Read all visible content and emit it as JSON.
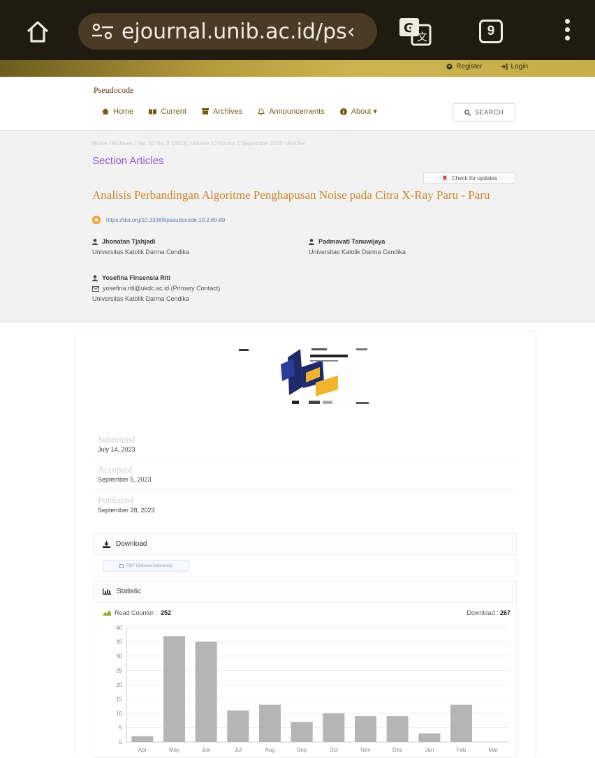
{
  "browser": {
    "url": "ejournal.unib.ac.id/ps‹",
    "tab_count": "9"
  },
  "top_bar": {
    "register_label": "Register",
    "login_label": "Login"
  },
  "site": {
    "brand": "Pseudocode",
    "nav": [
      {
        "label": "Home",
        "icon": "home-icon"
      },
      {
        "label": "Current",
        "icon": "book-icon"
      },
      {
        "label": "Archives",
        "icon": "archive-icon"
      },
      {
        "label": "Announcements",
        "icon": "bell-icon"
      },
      {
        "label": "About ▾",
        "icon": "info-icon"
      }
    ],
    "search_label": "SEARCH"
  },
  "article": {
    "breadcrumb": "Home  /  Archives  /  Vol. 10 No. 2 (2023): Volume 10 Nomor 2 September 2023  /  Articles",
    "section_title": "Section Articles",
    "check_updates_label": "Check for updates",
    "title": "Analisis Perbandingan Algoritme Penghapusan Noise pada Citra X-Ray Paru - Paru",
    "doi": "https://doi.org/10.33369/pseudocode.10.2.80-89",
    "authors": [
      {
        "name": "Jhonatan Tjahjadi",
        "affiliation": "Universitas Katolik Darma Cendika"
      },
      {
        "name": "Padmavati Tanuwijaya",
        "affiliation": "Universitas Katolik Darma Cendika"
      },
      {
        "name": "Yosefina Finsensia Riti",
        "email": "yosefina.riti@ukdc.ac.id (Primary Contact)",
        "affiliation": "Universitas Katolik Darma Cendika"
      }
    ]
  },
  "dates": {
    "submitted_label": "Submitted",
    "submitted": "July 14, 2023",
    "accepted_label": "Accepted",
    "accepted": "September 5, 2023",
    "published_label": "Published",
    "published": "September 28, 2023"
  },
  "download": {
    "title": "Download",
    "pdf_label": "PDF (Bahasa Indonesia)"
  },
  "statistic": {
    "title": "Statistic",
    "read_counter_label": "Read Counter :",
    "read_counter": "252",
    "download_label": "Download :",
    "download_count": "267"
  },
  "chart_data": {
    "type": "bar",
    "categories": [
      "Apr",
      "May",
      "Jun",
      "Jul",
      "Aug",
      "Sep",
      "Oct",
      "Nov",
      "Dec",
      "Jan",
      "Feb",
      "Mar"
    ],
    "values": [
      2,
      37,
      35,
      11,
      13,
      7,
      10,
      9,
      9,
      3,
      13,
      0
    ],
    "yticks": [
      0,
      5,
      10,
      15,
      20,
      25,
      30,
      35,
      40
    ],
    "ylim": [
      0,
      40
    ],
    "bar_color": "#b5b5b5",
    "grid": true
  },
  "colors": {
    "accent_gold": "#c6ad48",
    "title_orange": "#c9852d",
    "section_purple": "#8d55c7"
  }
}
